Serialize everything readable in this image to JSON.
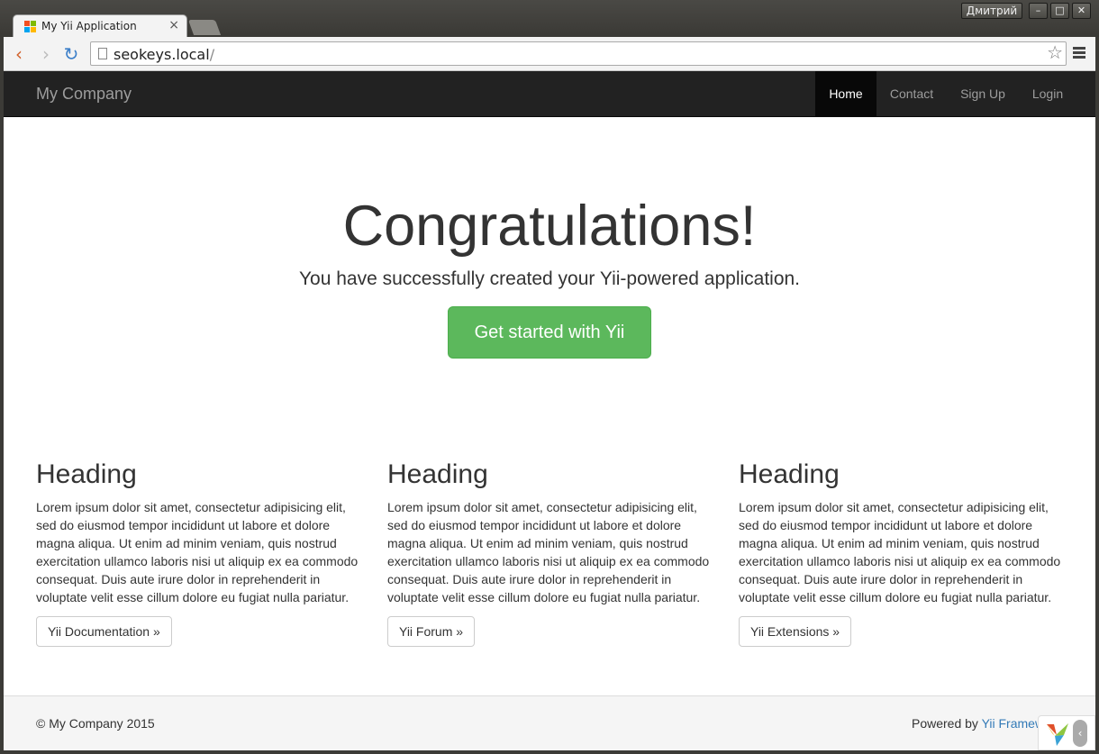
{
  "browser": {
    "tab_title": "My Yii Application",
    "tab_close": "×",
    "user_name": "Дмитрий",
    "url_host": "seokeys.local",
    "url_path": "/",
    "window_buttons": [
      "–",
      "□",
      "✕"
    ]
  },
  "navbar": {
    "brand": "My Company",
    "items": [
      {
        "label": "Home",
        "active": true
      },
      {
        "label": "Contact"
      },
      {
        "label": "Sign Up"
      },
      {
        "label": "Login"
      }
    ]
  },
  "jumbotron": {
    "title": "Congratulations!",
    "lead": "You have successfully created your Yii-powered application.",
    "button": "Get started with Yii"
  },
  "columns": [
    {
      "heading": "Heading",
      "text": "Lorem ipsum dolor sit amet, consectetur adipisicing elit, sed do eiusmod tempor incididunt ut labore et dolore magna aliqua. Ut enim ad minim veniam, quis nostrud exercitation ullamco laboris nisi ut aliquip ex ea commodo consequat. Duis aute irure dolor in reprehenderit in voluptate velit esse cillum dolore eu fugiat nulla pariatur.",
      "button": "Yii Documentation »"
    },
    {
      "heading": "Heading",
      "text": "Lorem ipsum dolor sit amet, consectetur adipisicing elit, sed do eiusmod tempor incididunt ut labore et dolore magna aliqua. Ut enim ad minim veniam, quis nostrud exercitation ullamco laboris nisi ut aliquip ex ea commodo consequat. Duis aute irure dolor in reprehenderit in voluptate velit esse cillum dolore eu fugiat nulla pariatur.",
      "button": "Yii Forum »"
    },
    {
      "heading": "Heading",
      "text": "Lorem ipsum dolor sit amet, consectetur adipisicing elit, sed do eiusmod tempor incididunt ut labore et dolore magna aliqua. Ut enim ad minim veniam, quis nostrud exercitation ullamco laboris nisi ut aliquip ex ea commodo consequat. Duis aute irure dolor in reprehenderit in voluptate velit esse cillum dolore eu fugiat nulla pariatur.",
      "button": "Yii Extensions »"
    }
  ],
  "footer": {
    "copyright": "© My Company 2015",
    "powered_prefix": "Powered by ",
    "powered_link": "Yii Framework"
  },
  "icons": {
    "back": "back-arrow-icon",
    "forward": "forward-arrow-icon",
    "reload": "reload-icon",
    "bookmark": "star-icon",
    "menu": "hamburger-menu-icon",
    "debug": "yii-logo-icon"
  },
  "colors": {
    "navbar_bg": "#222222",
    "success": "#5cb85c",
    "link": "#337ab7"
  }
}
